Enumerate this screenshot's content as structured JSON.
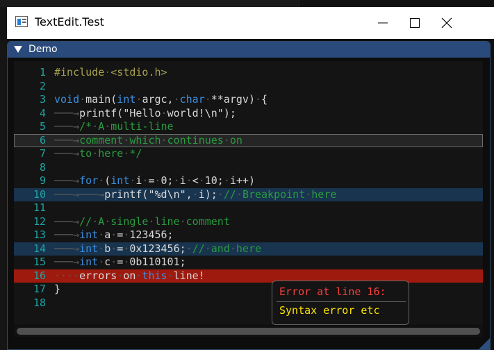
{
  "window": {
    "title": "TextEdit.Test"
  },
  "demo": {
    "title": "Demo"
  },
  "editor": {
    "lines": [
      {
        "num": "1",
        "tokens": [
          {
            "t": "#include",
            "c": "pre"
          },
          {
            "t": "·",
            "c": "ws"
          },
          {
            "t": "<stdio.h>",
            "c": "pre"
          }
        ]
      },
      {
        "num": "2",
        "tokens": []
      },
      {
        "num": "3",
        "tokens": [
          {
            "t": "void",
            "c": "kw"
          },
          {
            "t": "·",
            "c": "ws"
          },
          {
            "t": "main(",
            "c": "fn"
          },
          {
            "t": "int",
            "c": "kw"
          },
          {
            "t": "·",
            "c": "ws"
          },
          {
            "t": "argc,",
            "c": "fn"
          },
          {
            "t": "·",
            "c": "ws"
          },
          {
            "t": "char",
            "c": "kw"
          },
          {
            "t": "·",
            "c": "ws"
          },
          {
            "t": "**argv)",
            "c": "fn"
          },
          {
            "t": "·",
            "c": "ws"
          },
          {
            "t": "{",
            "c": "fn"
          }
        ]
      },
      {
        "num": "4",
        "tokens": [
          {
            "t": "───→",
            "c": "ws"
          },
          {
            "t": "printf(\"Hello",
            "c": "fn"
          },
          {
            "t": "·",
            "c": "ws"
          },
          {
            "t": "world!\\n\");",
            "c": "fn"
          }
        ]
      },
      {
        "num": "5",
        "tokens": [
          {
            "t": "───→",
            "c": "ws"
          },
          {
            "t": "/*",
            "c": "cm"
          },
          {
            "t": "·",
            "c": "ws"
          },
          {
            "t": "A",
            "c": "cm"
          },
          {
            "t": "·",
            "c": "ws"
          },
          {
            "t": "multi-line",
            "c": "cm"
          }
        ]
      },
      {
        "num": "6",
        "tokens": [
          {
            "t": "───→",
            "c": "ws"
          },
          {
            "t": "comment",
            "c": "cm"
          },
          {
            "t": "·",
            "c": "ws"
          },
          {
            "t": "which",
            "c": "cm"
          },
          {
            "t": "·",
            "c": "ws"
          },
          {
            "t": "continues",
            "c": "cm"
          },
          {
            "t": "·",
            "c": "ws"
          },
          {
            "t": "on",
            "c": "cm"
          }
        ]
      },
      {
        "num": "7",
        "tokens": [
          {
            "t": "───→",
            "c": "ws"
          },
          {
            "t": "to",
            "c": "cm"
          },
          {
            "t": "·",
            "c": "ws"
          },
          {
            "t": "here",
            "c": "cm"
          },
          {
            "t": "·",
            "c": "ws"
          },
          {
            "t": "*/",
            "c": "cm"
          }
        ]
      },
      {
        "num": "8",
        "tokens": []
      },
      {
        "num": "9",
        "tokens": [
          {
            "t": "───→",
            "c": "ws"
          },
          {
            "t": "for",
            "c": "kw"
          },
          {
            "t": "·",
            "c": "ws"
          },
          {
            "t": "(",
            "c": "fn"
          },
          {
            "t": "int",
            "c": "kw"
          },
          {
            "t": "·",
            "c": "ws"
          },
          {
            "t": "i",
            "c": "fn"
          },
          {
            "t": "·",
            "c": "ws"
          },
          {
            "t": "=",
            "c": "fn"
          },
          {
            "t": "·",
            "c": "ws"
          },
          {
            "t": "0;",
            "c": "fn"
          },
          {
            "t": "·",
            "c": "ws"
          },
          {
            "t": "i",
            "c": "fn"
          },
          {
            "t": "·",
            "c": "ws"
          },
          {
            "t": "<",
            "c": "fn"
          },
          {
            "t": "·",
            "c": "ws"
          },
          {
            "t": "10;",
            "c": "fn"
          },
          {
            "t": "·",
            "c": "ws"
          },
          {
            "t": "i++)",
            "c": "fn"
          }
        ]
      },
      {
        "num": "10",
        "tokens": [
          {
            "t": "───→───→",
            "c": "ws"
          },
          {
            "t": "printf(\"%d\\n\",",
            "c": "fn"
          },
          {
            "t": "·",
            "c": "ws"
          },
          {
            "t": "i);",
            "c": "fn"
          },
          {
            "t": "·",
            "c": "ws"
          },
          {
            "t": "//",
            "c": "cm"
          },
          {
            "t": "·",
            "c": "ws"
          },
          {
            "t": "Breakpoint",
            "c": "cm"
          },
          {
            "t": "·",
            "c": "ws"
          },
          {
            "t": "here",
            "c": "cm"
          }
        ]
      },
      {
        "num": "11",
        "tokens": []
      },
      {
        "num": "12",
        "tokens": [
          {
            "t": "───→",
            "c": "ws"
          },
          {
            "t": "//",
            "c": "cm"
          },
          {
            "t": "·",
            "c": "ws"
          },
          {
            "t": "A",
            "c": "cm"
          },
          {
            "t": "·",
            "c": "ws"
          },
          {
            "t": "single",
            "c": "cm"
          },
          {
            "t": "·",
            "c": "ws"
          },
          {
            "t": "line",
            "c": "cm"
          },
          {
            "t": "·",
            "c": "ws"
          },
          {
            "t": "comment",
            "c": "cm"
          }
        ]
      },
      {
        "num": "13",
        "tokens": [
          {
            "t": "───→",
            "c": "ws"
          },
          {
            "t": "int",
            "c": "kw"
          },
          {
            "t": "·",
            "c": "ws"
          },
          {
            "t": "a",
            "c": "fn"
          },
          {
            "t": "·",
            "c": "ws"
          },
          {
            "t": "=",
            "c": "fn"
          },
          {
            "t": "·",
            "c": "ws"
          },
          {
            "t": "123456;",
            "c": "fn"
          }
        ]
      },
      {
        "num": "14",
        "tokens": [
          {
            "t": "───→",
            "c": "ws"
          },
          {
            "t": "int",
            "c": "kw"
          },
          {
            "t": "·",
            "c": "ws"
          },
          {
            "t": "b",
            "c": "fn"
          },
          {
            "t": "·",
            "c": "ws"
          },
          {
            "t": "=",
            "c": "fn"
          },
          {
            "t": "·",
            "c": "ws"
          },
          {
            "t": "0x123456;",
            "c": "fn"
          },
          {
            "t": "·",
            "c": "ws"
          },
          {
            "t": "//",
            "c": "cm"
          },
          {
            "t": "·",
            "c": "ws"
          },
          {
            "t": "and",
            "c": "cm"
          },
          {
            "t": "·",
            "c": "ws"
          },
          {
            "t": "here",
            "c": "cm"
          }
        ]
      },
      {
        "num": "15",
        "tokens": [
          {
            "t": "───→",
            "c": "ws"
          },
          {
            "t": "int",
            "c": "kw"
          },
          {
            "t": "·",
            "c": "ws"
          },
          {
            "t": "c",
            "c": "fn"
          },
          {
            "t": "·",
            "c": "ws"
          },
          {
            "t": "=",
            "c": "fn"
          },
          {
            "t": "·",
            "c": "ws"
          },
          {
            "t": "0b110101;",
            "c": "fn"
          }
        ]
      },
      {
        "num": "16",
        "tokens": [
          {
            "t": "····",
            "c": "ws"
          },
          {
            "t": "errors",
            "c": "fn"
          },
          {
            "t": "·",
            "c": "ws"
          },
          {
            "t": "on",
            "c": "fn"
          },
          {
            "t": "·",
            "c": "ws"
          },
          {
            "t": "this",
            "c": "kw"
          },
          {
            "t": "·",
            "c": "ws"
          },
          {
            "t": "line!",
            "c": "fn"
          }
        ]
      },
      {
        "num": "17",
        "tokens": [
          {
            "t": "}",
            "c": "fn"
          }
        ]
      },
      {
        "num": "18",
        "tokens": []
      }
    ],
    "current_line": "6",
    "breakpoint_lines": [
      "10",
      "14"
    ],
    "error_line": "16"
  },
  "tooltip": {
    "title": "Error at line 16:",
    "message": "Syntax error etc"
  },
  "colors": {
    "line_number": "#21a3a3",
    "keyword": "#3b8ee0",
    "comment": "#2a9b40",
    "preprocessor": "#a8a14e",
    "error_bg": "#9e1a0f",
    "breakpoint_bg": "#18344f",
    "header_bg": "#294a7a"
  }
}
